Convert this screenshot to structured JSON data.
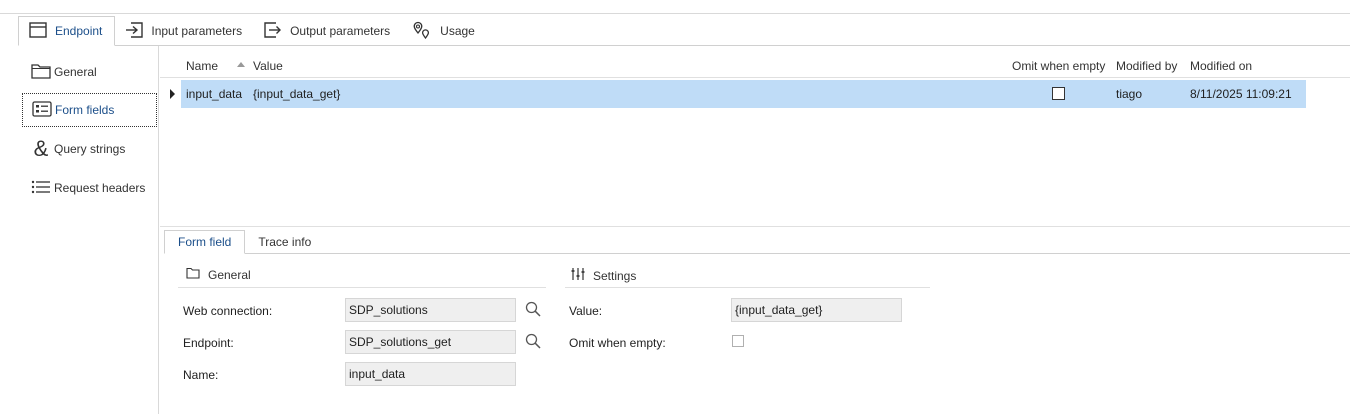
{
  "tabs": [
    {
      "label": "Endpoint",
      "icon": "window-icon"
    },
    {
      "label": "Input parameters",
      "icon": "arrow-into-box-icon"
    },
    {
      "label": "Output parameters",
      "icon": "arrow-out-box-icon"
    },
    {
      "label": "Usage",
      "icon": "location-pins-icon"
    }
  ],
  "nav": [
    {
      "label": "General",
      "icon": "folder-icon"
    },
    {
      "label": "Form fields",
      "icon": "form-icon"
    },
    {
      "label": "Query strings",
      "icon": "ampersand-icon"
    },
    {
      "label": "Request headers",
      "icon": "list-icon"
    }
  ],
  "grid": {
    "columns": {
      "name": "Name",
      "value": "Value",
      "omit": "Omit when empty",
      "modified_by": "Modified by",
      "modified_on": "Modified on"
    },
    "rows": [
      {
        "name": "input_data",
        "value": "{input_data_get}",
        "omit": false,
        "modified_by": "tiago",
        "modified_on": "8/11/2025 11:09:21"
      }
    ]
  },
  "bottom_tabs": [
    "Form field",
    "Trace info"
  ],
  "form": {
    "general_title": "General",
    "settings_title": "Settings",
    "web_connection_label": "Web connection:",
    "web_connection_value": "SDP_solutions",
    "endpoint_label": "Endpoint:",
    "endpoint_value": "SDP_solutions_get",
    "name_label": "Name:",
    "name_value": "input_data",
    "value_label": "Value:",
    "value_value": "{input_data_get}",
    "omit_label": "Omit when empty:",
    "omit_checked": false
  },
  "colors": {
    "accent": "#1c4f8a",
    "selection": "#bfdcf7"
  }
}
